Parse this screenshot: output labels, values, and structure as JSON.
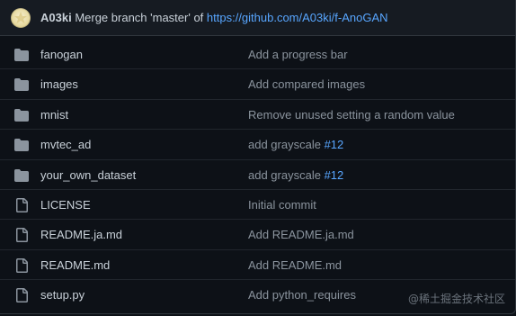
{
  "commit": {
    "author": "A03ki",
    "message_prefix": " Merge branch 'master' of ",
    "link_text": "https://github.com/A03ki/f-AnoGAN"
  },
  "files": [
    {
      "type": "folder",
      "name": "fanogan",
      "message": "Add a progress bar",
      "issue": ""
    },
    {
      "type": "folder",
      "name": "images",
      "message": "Add compared images",
      "issue": ""
    },
    {
      "type": "folder",
      "name": "mnist",
      "message": "Remove unused setting a random value",
      "issue": ""
    },
    {
      "type": "folder",
      "name": "mvtec_ad",
      "message": "add grayscale ",
      "issue": "#12"
    },
    {
      "type": "folder",
      "name": "your_own_dataset",
      "message": "add grayscale ",
      "issue": "#12"
    },
    {
      "type": "file",
      "name": "LICENSE",
      "message": "Initial commit",
      "issue": ""
    },
    {
      "type": "file",
      "name": "README.ja.md",
      "message": "Add README.ja.md",
      "issue": ""
    },
    {
      "type": "file",
      "name": "README.md",
      "message": "Add README.md",
      "issue": ""
    },
    {
      "type": "file",
      "name": "setup.py",
      "message": "Add python_requires",
      "issue": ""
    }
  ],
  "watermark": "@稀土掘金技术社区",
  "colors": {
    "background": "#0d1117",
    "header": "#161b22",
    "border": "#30363d",
    "text": "#c9d1d9",
    "muted": "#8b949e",
    "link": "#58a6ff"
  }
}
